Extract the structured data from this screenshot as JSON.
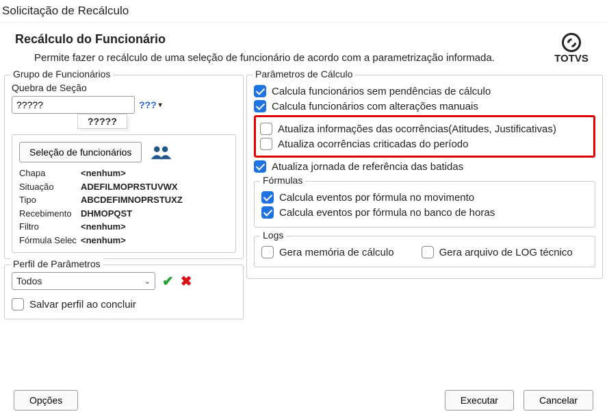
{
  "window": {
    "title": "Solicitação de Recálculo"
  },
  "header": {
    "title": "Recálculo do Funcionário",
    "subtitle": "Permite fazer o recálculo de uma seleção de funcionário de acordo com a parametrização informada.",
    "brand": "TOTVS"
  },
  "left": {
    "grupo_title": "Grupo de Funcionários",
    "quebra_label": "Quebra de Seção",
    "quebra_value": "?????",
    "quebra_icon_label": "???",
    "tooltip": "?????",
    "selecao_btn": "Seleção de funcionários",
    "fields": {
      "chapa": {
        "label": "Chapa",
        "value": "<nenhum>"
      },
      "situacao": {
        "label": "Situação",
        "value": "ADEFILMOPRSTUVWX"
      },
      "tipo": {
        "label": "Tipo",
        "value": "ABCDEFIMNOPRSTUXZ"
      },
      "recebimento": {
        "label": "Recebimento",
        "value": "DHMOPQST"
      },
      "filtro": {
        "label": "Filtro",
        "value": "<nenhum>"
      },
      "formula": {
        "label": "Fórmula Selec",
        "value": "<nenhum>"
      }
    },
    "perfil_title": "Perfil de Parâmetros",
    "perfil_value": "Todos",
    "salvar_perfil": "Salvar perfil ao concluir"
  },
  "right": {
    "parametros_title": "Parâmetros de Cálculo",
    "c1": "Calcula funcionários sem pendências de cálculo",
    "c2": "Calcula funcionários com alterações manuais",
    "c3": "Atualiza informações das ocorrências(Atitudes, Justificativas)",
    "c4": "Atualiza ocorrências criticadas do período",
    "c5": "Atualiza jornada de referência das batidas",
    "formulas_title": "Fórmulas",
    "f1": "Calcula eventos por fórmula no movimento",
    "f2": "Calcula eventos por fórmula no banco de horas",
    "logs_title": "Logs",
    "l1": "Gera memória de cálculo",
    "l2": "Gera arquivo de LOG técnico"
  },
  "footer": {
    "opcoes": "Opções",
    "executar": "Executar",
    "cancelar": "Cancelar"
  },
  "checks": {
    "c1": true,
    "c2": true,
    "c3": false,
    "c4": false,
    "c5": true,
    "f1": true,
    "f2": true,
    "l1": false,
    "l2": false,
    "salvar": false
  }
}
